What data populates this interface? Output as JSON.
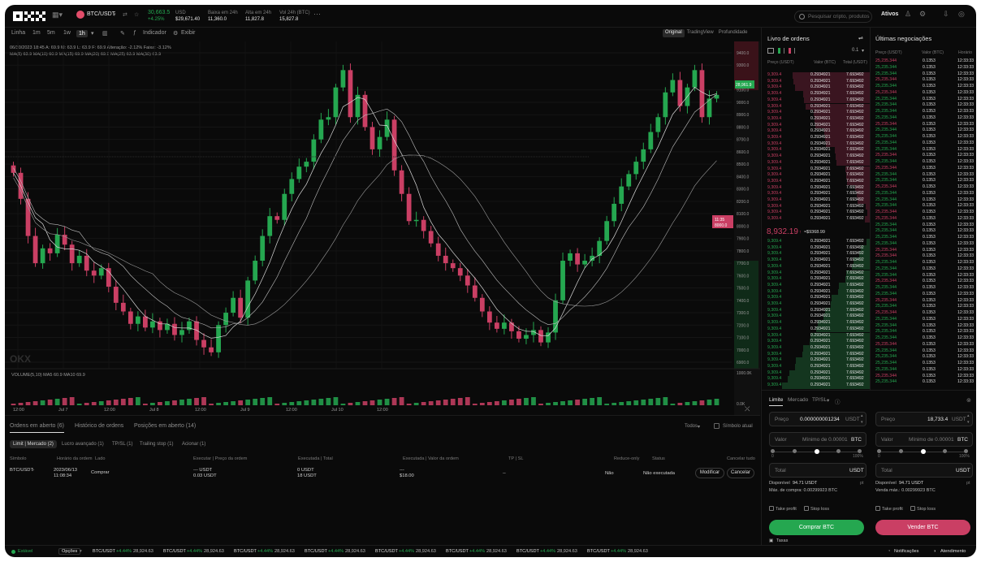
{
  "topbar": {
    "pair": "BTC/USDT",
    "last_price": "30,663.5",
    "change": "+4.25%",
    "usd_label": "USD",
    "usd_value": "$29,671.40",
    "low_label": "Baixa em 24h",
    "low_value": "11,360.0",
    "high_label": "Alta em 24h",
    "high_value": "11,827.8",
    "vol_label": "Vol 24h (BTC)",
    "vol_value": "15,827.8",
    "search_placeholder": "Pesquisar cripto, produtos",
    "assets": "Ativos"
  },
  "toolbar": {
    "timeframes": [
      "Linha",
      "1m",
      "5m",
      "1w",
      "1h"
    ],
    "indicator": "Indicador",
    "display": "Exibir",
    "views": [
      "Original",
      "TradingView",
      "Profundidade"
    ]
  },
  "chart_legend": {
    "line1": "06/30/2023 18:45  A: 69.9  M: 63.9  L: 63.9  F: 69.9  Alteração: -2.12%  Faixa: -3.12%",
    "line2": "MA(5) 63.9  MA(10) 60.9  MA(15) 69.9  MA(20) 69.9  MA(25) 63.9  MA(30) 63.9",
    "volume": "VOLUME(5,10)  MA5 60.9  MA10 69.9",
    "watermark": "OKX"
  },
  "chart_data": {
    "type": "candlestick",
    "y_ticks": [
      "9400.0",
      "9300.0",
      "9100.0",
      "9000.0",
      "8900.0",
      "8800.0",
      "8700.0",
      "8600.0",
      "8500.0",
      "8400.0",
      "8300.0",
      "8200.0",
      "8100.0",
      "8000.0",
      "7900.0",
      "7800.0",
      "7700.0",
      "7600.0",
      "7500.0",
      "7400.0",
      "7300.0",
      "7200.0",
      "7100.0",
      "7000.0",
      "6900.0"
    ],
    "x_ticks": [
      "12:00",
      "Jul 7",
      "12:00",
      "Jul 8",
      "12:00",
      "Jul 9",
      "12:00",
      "Jul 10",
      "12:00"
    ],
    "current_price_tag": "28,961.9",
    "marker_tag_1": "11:35",
    "marker_tag_2": "8000.0",
    "volume_ticks": [
      "1000.0K",
      "0.0K"
    ],
    "up_color": "#25a750",
    "down_color": "#ca3f64",
    "closes": [
      8430,
      8220,
      7920,
      7700,
      7820,
      7780,
      7930,
      7850,
      7700,
      7760,
      7640,
      7600,
      7660,
      7510,
      7380,
      7310,
      7210,
      7270,
      7180,
      7230,
      7160,
      7210,
      7120,
      7160,
      7230,
      7080,
      7020,
      6980,
      7200,
      7300,
      7420,
      7260,
      7560,
      7720,
      7920,
      8080,
      8050,
      8260,
      8380,
      8480,
      8520,
      8700,
      8860,
      8880,
      9120,
      9260,
      8880,
      9060,
      8800,
      8620,
      8720,
      8860,
      8450,
      8260,
      8040,
      8050,
      7960,
      7860,
      7760,
      7700,
      7660,
      7600,
      7520,
      7420,
      7310,
      7220,
      7170,
      7220,
      7150,
      7090,
      7120,
      7160,
      7060,
      7140,
      7400,
      7720,
      7780,
      7690,
      7720,
      7760,
      7880,
      8040,
      8180,
      8320,
      8420,
      8520,
      8620,
      8760,
      8880,
      9080,
      9180,
      8970,
      9120,
      9260,
      8880,
      9030,
      9060
    ]
  },
  "orderbook": {
    "title": "Livro de ordens",
    "step": "0.1",
    "headers": [
      "Preço (USDT)",
      "Valor (BTC)",
      "Total (USDT)"
    ],
    "ask_price": "9,309.4",
    "row_amount": "0.2934921",
    "row_total": "7.693492",
    "mid_price": "8,932.19",
    "mid_usd": "≈$9368.99"
  },
  "trades": {
    "title": "Últimas negociações",
    "headers": [
      "Preço (USDT)",
      "Valor (BTC)",
      "Horário"
    ],
    "price": "25,235.344",
    "amount": "0.1353",
    "time": "12:33:33"
  },
  "orders": {
    "tabs": [
      "Ordens em aberto (6)",
      "Histórico de ordens",
      "Posições em aberto (14)"
    ],
    "filter": "Todos",
    "current_symbol": "Símbolo atual",
    "chips": [
      "Limit | Mercado (2)",
      "Lucro avançado (1)",
      "TP/SL (1)",
      "Trailing stop (1)",
      "Acionar (1)"
    ],
    "columns": [
      "Símbolo",
      "Horário da ordem",
      "Lado",
      "Executar | Preço da ordem",
      "Executada | Total",
      "Executada | Valor da ordem",
      "TP | SL",
      "Reduce-only",
      "Status",
      "Cancelar tudo"
    ],
    "row": {
      "symbol": "BTC/USDT",
      "date": "2023/06/13",
      "time": "11:08:34",
      "side": "Comprar",
      "exec_price": "--- USDT",
      "order_price": "0.03 USDT",
      "executed": "0 USDT",
      "total": "18 USDT",
      "exec_value": "---",
      "order_value": "$18.00",
      "tpsl": "--",
      "reduce": "Não",
      "status": "Não executada",
      "modify": "Modificar",
      "cancel": "Cancelar"
    }
  },
  "form": {
    "tabs": [
      "Limite",
      "Mercado",
      "TP/SL"
    ],
    "price_label": "Preço",
    "buy_price": "0.000000001234",
    "sell_price": "18,733.4",
    "currency": "USDT",
    "value_label": "Valor",
    "value_placeholder": "Mínimo de 0.00001",
    "btc": "BTC",
    "pct0": "0",
    "pct100": "100%",
    "total_label": "Total",
    "available_label": "Disponível",
    "available_value": "94.71 USDT",
    "max_buy": "Máx. de compra: 0.00299923 BTC",
    "max_sell": "Venda máx.: 0.00299923 BTC",
    "pct_sign": "pt",
    "take_profit": "Take profit",
    "stop_loss": "Stop loss",
    "buy_button": "Comprar BTC",
    "sell_button": "Vender BTC",
    "fees": "Taxas"
  },
  "statusbar": {
    "stable": "Estável",
    "options": "Opções",
    "ticker_pair": "BTC/USDT",
    "ticker_change": "+4.44%",
    "ticker_price": "28,924.63",
    "notifications": "Notificações",
    "support": "Atendimento"
  }
}
